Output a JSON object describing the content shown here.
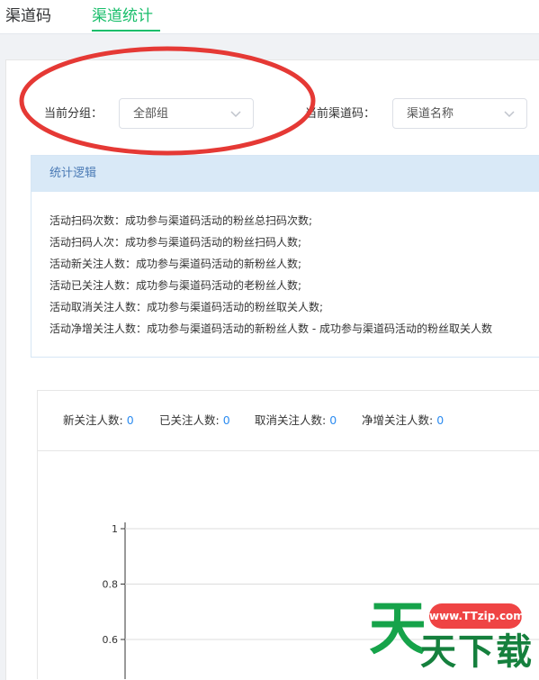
{
  "tabs": [
    {
      "label": "渠道码",
      "active": false
    },
    {
      "label": "渠道统计",
      "active": true
    }
  ],
  "filters": {
    "group_label": "当前分组：",
    "group_value": "全部组",
    "channel_label": "当前渠道码：",
    "channel_value": "渠道名称"
  },
  "info": {
    "title": "统计逻辑",
    "rules": [
      "活动扫码次数：成功参与渠道码活动的粉丝总扫码次数;",
      "活动扫码人次：成功参与渠道码活动的粉丝扫码人数;",
      "活动新关注人数：成功参与渠道码活动的新粉丝人数;",
      "活动已关注人数：成功参与渠道码活动的老粉丝人数;",
      "活动取消关注人数：成功参与渠道码活动的粉丝取关人数;",
      "活动净增关注人数：成功参与渠道码活动的新粉丝人数 - 成功参与渠道码活动的粉丝取关人数"
    ]
  },
  "stats": [
    {
      "label": "新关注人数:",
      "value": "0"
    },
    {
      "label": "已关注人数:",
      "value": "0"
    },
    {
      "label": "取消关注人数:",
      "value": "0"
    },
    {
      "label": "净增关注人数:",
      "value": "0"
    }
  ],
  "chart_data": {
    "type": "line",
    "y_ticks": [
      "1",
      "0.8",
      "0.6"
    ],
    "ylim": [
      0,
      1
    ],
    "series": [],
    "grid": true
  },
  "watermark": {
    "url": "www.TTzip.com",
    "big_char": "天",
    "small_chars": "天下载"
  },
  "colors": {
    "accent": "#19be6b",
    "number": "#2d8cf0",
    "annotation": "#e53935"
  }
}
